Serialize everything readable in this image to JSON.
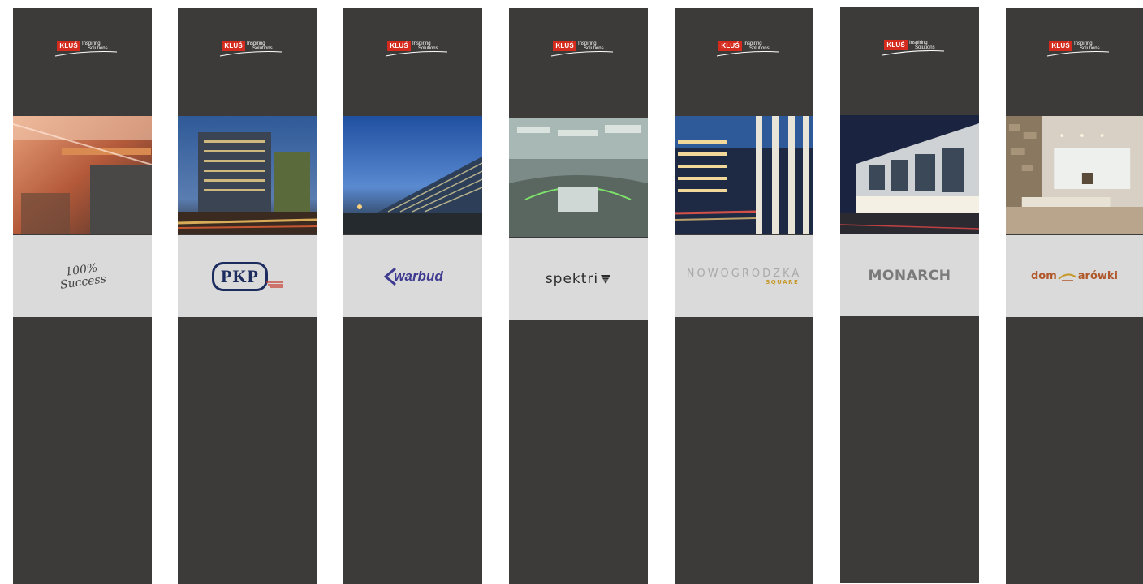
{
  "logo": {
    "brand": "KLUŚ",
    "tag_line1": "Inspiring",
    "tag_line2": "Solutions"
  },
  "banners": [
    {
      "client": "100% Success",
      "client_line1": "100%",
      "client_line2": "Success"
    },
    {
      "client": "PKP"
    },
    {
      "client": "warbud"
    },
    {
      "client": "spektri"
    },
    {
      "client": "NOWOGRODZKA",
      "client_sub": "SQUARE"
    },
    {
      "client": "MONARCH"
    },
    {
      "client_a": "dom",
      "client_b": "arówki"
    }
  ],
  "colors": {
    "banner_bg": "#3c3b3a",
    "client_band": "#dadadb",
    "brand_red": "#d52b1e"
  }
}
